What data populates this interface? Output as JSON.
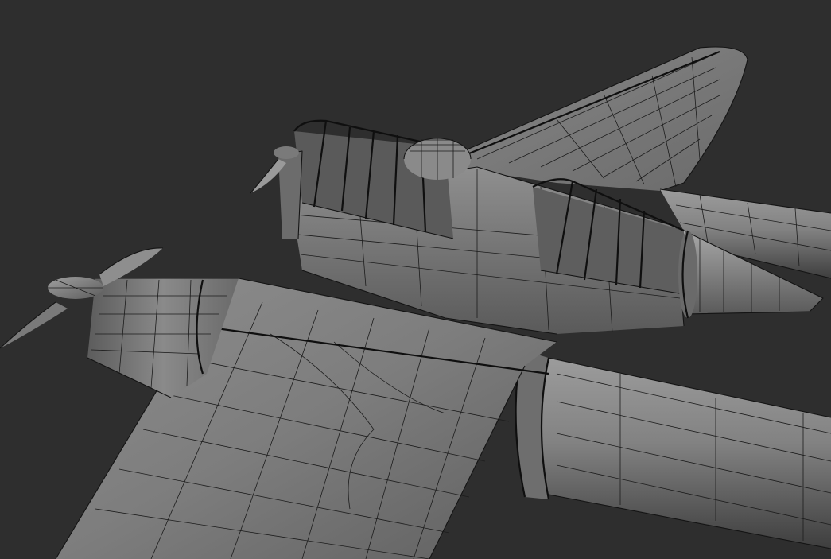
{
  "scene": {
    "background_color": "#2e2e2e",
    "shade_light": "#9a9a9a",
    "shade_mid": "#7a7a7a",
    "shade_dark": "#4a4a4a",
    "wire_color": "#141414",
    "objects": [
      "wing",
      "fuselage",
      "engine-nacelle",
      "propeller",
      "cockpit-canopy",
      "tail-boom",
      "nose-cone",
      "gun-turret"
    ]
  }
}
